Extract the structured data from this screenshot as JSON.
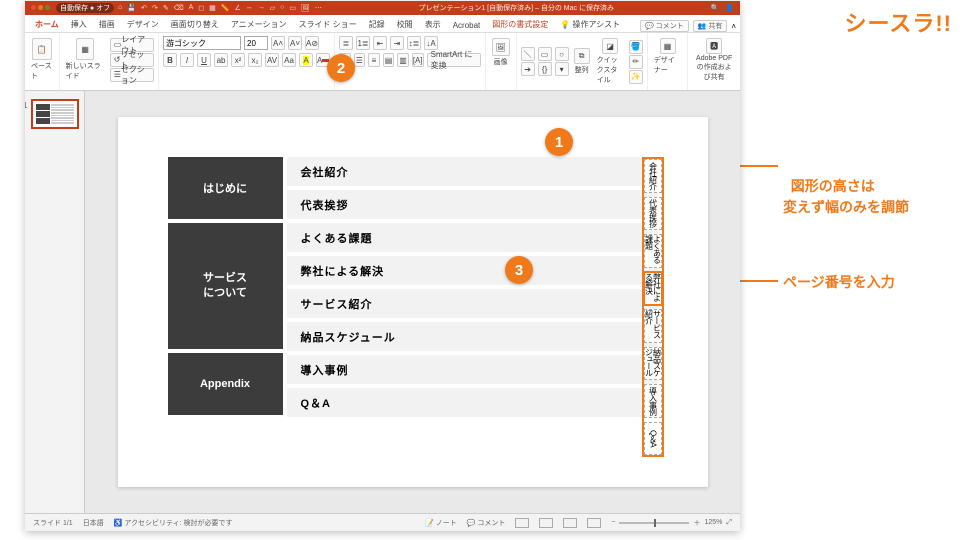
{
  "brand": "シースラ!!",
  "titlebar": {
    "autosave": "自動保存 ● オフ",
    "title": "プレゼンテーション1 [自動保存済み] – 自分の Mac に保存済み"
  },
  "qat_icons": [
    "home",
    "save",
    "undo",
    "redo",
    "brush",
    "eraser",
    "text",
    "shape",
    "table",
    "ruler",
    "angle",
    "arrow-right",
    "arrow-shape",
    "circle",
    "square",
    "picture",
    "dots"
  ],
  "tabs": {
    "items": [
      "ホーム",
      "挿入",
      "描画",
      "デザイン",
      "画面切り替え",
      "アニメーション",
      "スライド ショー",
      "記録",
      "校閲",
      "表示",
      "Acrobat"
    ],
    "context": "図形の書式設定",
    "tell_me": "操作アシスト",
    "right": {
      "comment": "コメント",
      "share": "共有"
    }
  },
  "ribbon": {
    "paste": "ペースト",
    "new_slide": "新しいスライド",
    "layout": "レイアウト",
    "reset": "リセット",
    "section": "セクション",
    "font_name": "游ゴシック",
    "font_size": "20",
    "smartart": "SmartArt に変換",
    "picture": "画像",
    "arrange": "整列",
    "quick": "クイックスタイル",
    "designer": "デザイナー",
    "adobe": "Adobe PDF の作成および共有"
  },
  "slide": {
    "sections": [
      {
        "label": "はじめに",
        "rows": 2
      },
      {
        "label": "サービス\nについて",
        "rows": 4
      },
      {
        "label": "Appendix",
        "rows": 2
      }
    ],
    "items": [
      "会社紹介",
      "代表挨拶",
      "よくある課題",
      "弊社による解決",
      "サービス紹介",
      "納品スケジュール",
      "導入事例",
      "Q＆A"
    ],
    "narrow_text": [
      "会社紹介",
      "代表挨拶",
      "よくある課題",
      "弊社による解決",
      "サービス紹介",
      "納品スケジュール",
      "導入事例",
      "Q＆A"
    ],
    "selected_narrow": 3
  },
  "status": {
    "slide": "スライド 1/1",
    "lang": "日本語",
    "a11y": "アクセシビリティ: 検討が必要です",
    "notes": "ノート",
    "comments": "コメント",
    "zoom": "125%"
  },
  "callouts": {
    "c1": "1",
    "c2": "2",
    "c3": "3"
  },
  "annotations": {
    "a1": "図形の高さは\n変えず幅のみを調節",
    "a3": "ページ番号を入力"
  }
}
